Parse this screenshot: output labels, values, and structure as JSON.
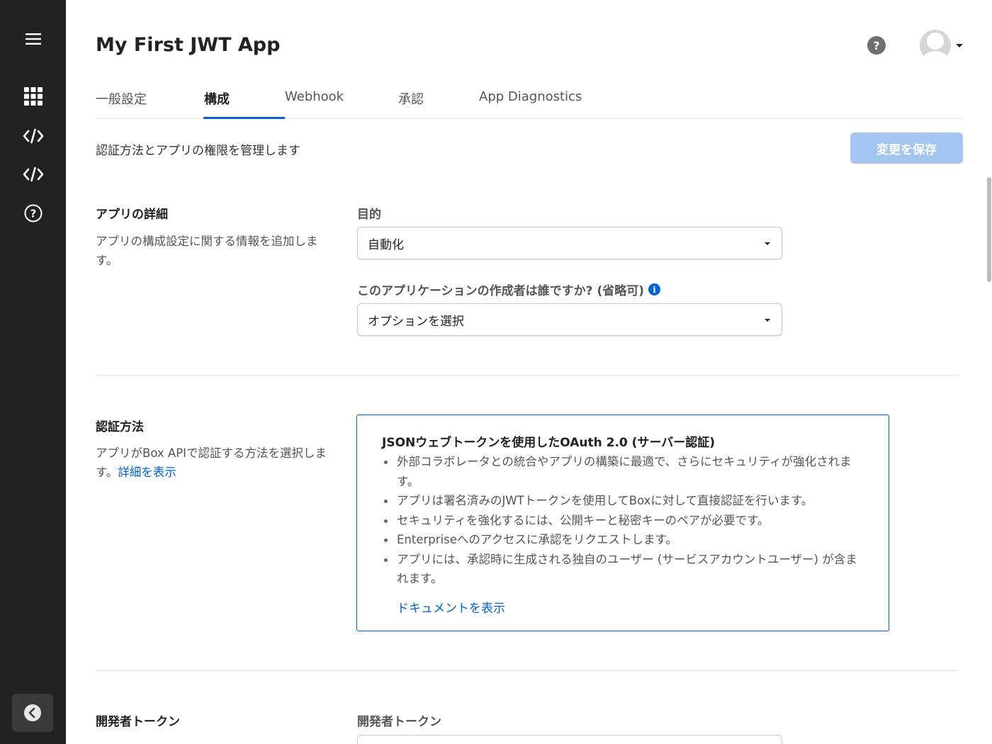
{
  "app": {
    "title": "My First JWT App"
  },
  "header": {
    "help_icon_glyph": "?"
  },
  "tabs": [
    {
      "label": "一般設定"
    },
    {
      "label": "構成"
    },
    {
      "label": "Webhook"
    },
    {
      "label": "承認"
    },
    {
      "label": "App Diagnostics"
    }
  ],
  "active_tab": "構成",
  "subtitle": "認証方法とアプリの権限を管理します",
  "save_button": "変更を保存",
  "app_details": {
    "title": "アプリの詳細",
    "description": "アプリの構成設定に関する情報を追加します。",
    "purpose_label": "目的",
    "purpose_value": "自動化",
    "creator_label": "このアプリケーションの作成者は誰ですか? (省略可)",
    "creator_value": "オプションを選択",
    "info_glyph": "i"
  },
  "auth_method": {
    "title": "認証方法",
    "description": "アプリがBox APIで認証する方法を選択します。",
    "details_link": "詳細を表示",
    "card": {
      "title": "JSONウェブトークンを使用したOAuth 2.0 (サーバー認証)",
      "bullets": [
        "外部コラボレータとの統合やアプリの構築に最適で、さらにセキュリティが強化されます。",
        "アプリは署名済みのJWTトークンを使用してBoxに対して直接認証を行います。",
        "セキュリティを強化するには、公開キーと秘密キーのペアが必要です。",
        "Enterpriseへのアクセスに承認をリクエストします。",
        "アプリには、承認時に生成される独自のユーザー (サービスアカウントユーザー) が含まれます。"
      ],
      "docs_link": "ドキュメントを表示"
    }
  },
  "dev_token": {
    "title": "開発者トークン",
    "field_label": "開発者トークン"
  },
  "colors": {
    "sidebar_bg": "#222222",
    "accent": "#0061d5",
    "save_disabled": "#a4c5ef"
  }
}
